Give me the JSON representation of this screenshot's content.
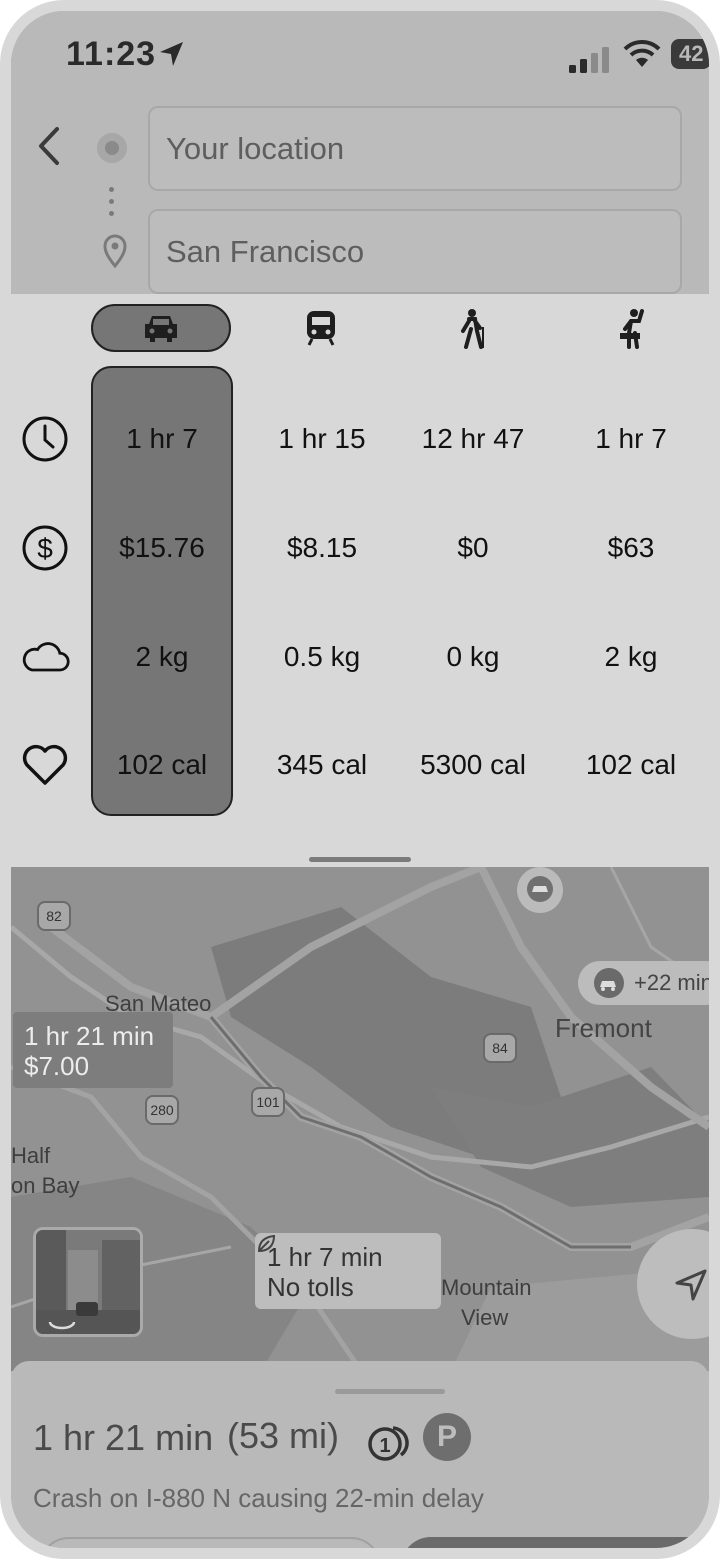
{
  "status_bar": {
    "time": "11:23",
    "battery": "42"
  },
  "search": {
    "origin": "Your location",
    "destination": "San Francisco"
  },
  "modes": [
    {
      "icon": "car-icon",
      "selected": true
    },
    {
      "icon": "transit-icon",
      "selected": false
    },
    {
      "icon": "walk-icon",
      "selected": false
    },
    {
      "icon": "rideshare-icon",
      "selected": false
    }
  ],
  "metrics": [
    {
      "icon": "clock-icon",
      "values": [
        "1 hr 7",
        "1 hr 15",
        "12 hr 47",
        "1 hr 7"
      ]
    },
    {
      "icon": "dollar-icon",
      "values": [
        "$15.76",
        "$8.15",
        "$0",
        "$63"
      ]
    },
    {
      "icon": "cloud-icon",
      "values": [
        "2 kg",
        "0.5 kg",
        "0 kg",
        "2 kg"
      ]
    },
    {
      "icon": "heart-icon",
      "values": [
        "102 cal",
        "345 cal",
        "5300 cal",
        "102 cal"
      ]
    }
  ],
  "map": {
    "places": [
      "San Mateo",
      "Fremont",
      "Half",
      "on Bay",
      "Mountain",
      "View"
    ],
    "shields": [
      "82",
      "84",
      "101",
      "280"
    ],
    "alt_route": {
      "line1": "1 hr 21 min",
      "line2": "$7.00"
    },
    "main_route": {
      "line1": "1 hr 7 min",
      "line2": "No tolls"
    },
    "delay_chip": "+22 min"
  },
  "summary": {
    "duration": "1 hr 21 min",
    "distance": "(53 mi)",
    "parking": "P",
    "incident": "Crash on I-880 N causing 22-min delay"
  }
}
